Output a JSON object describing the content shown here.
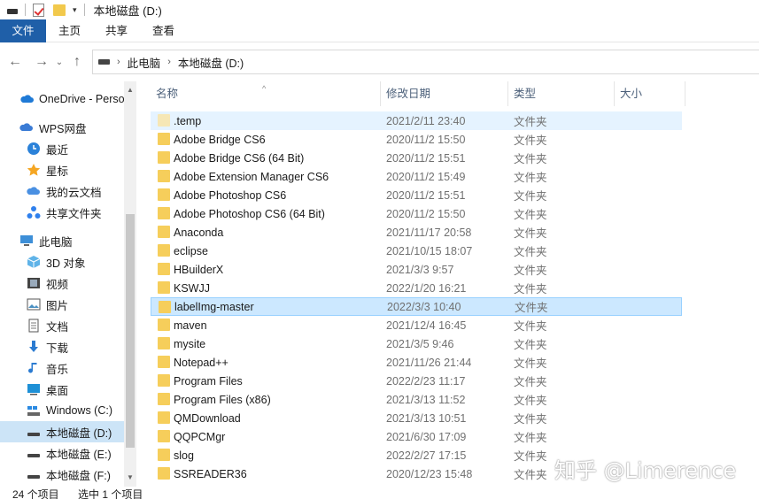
{
  "window": {
    "title": "本地磁盘 (D:)"
  },
  "ribbon": {
    "tabs": [
      "文件",
      "主页",
      "共享",
      "查看"
    ]
  },
  "address": {
    "crumbs": [
      "此电脑",
      "本地磁盘 (D:)"
    ]
  },
  "nav": {
    "items": [
      {
        "label": "OneDrive - Perso",
        "icon": "cloud-icon"
      },
      {
        "label": "WPS网盘",
        "icon": "wps-cloud-icon"
      },
      {
        "label": "最近",
        "icon": "clock-icon"
      },
      {
        "label": "星标",
        "icon": "star-icon"
      },
      {
        "label": "我的云文档",
        "icon": "cloud-doc-icon"
      },
      {
        "label": "共享文件夹",
        "icon": "share-folder-icon"
      },
      {
        "label": "此电脑",
        "icon": "computer-icon"
      },
      {
        "label": "3D 对象",
        "icon": "cube-icon"
      },
      {
        "label": "视频",
        "icon": "film-icon"
      },
      {
        "label": "图片",
        "icon": "picture-icon"
      },
      {
        "label": "文档",
        "icon": "document-icon"
      },
      {
        "label": "下载",
        "icon": "download-icon"
      },
      {
        "label": "音乐",
        "icon": "music-icon"
      },
      {
        "label": "桌面",
        "icon": "desktop-icon"
      },
      {
        "label": "Windows (C:)",
        "icon": "windows-drive-icon"
      },
      {
        "label": "本地磁盘 (D:)",
        "icon": "drive-icon"
      },
      {
        "label": "本地磁盘 (E:)",
        "icon": "drive-icon"
      },
      {
        "label": "本地磁盘 (F:)",
        "icon": "drive-icon"
      }
    ]
  },
  "columns": {
    "name": "名称",
    "date": "修改日期",
    "type": "类型",
    "size": "大小"
  },
  "files": [
    {
      "name": ".temp",
      "date": "2021/2/11 23:40",
      "type": "文件夹"
    },
    {
      "name": "Adobe Bridge CS6",
      "date": "2020/11/2 15:50",
      "type": "文件夹"
    },
    {
      "name": "Adobe Bridge CS6 (64 Bit)",
      "date": "2020/11/2 15:51",
      "type": "文件夹"
    },
    {
      "name": "Adobe Extension Manager CS6",
      "date": "2020/11/2 15:49",
      "type": "文件夹"
    },
    {
      "name": "Adobe Photoshop CS6",
      "date": "2020/11/2 15:51",
      "type": "文件夹"
    },
    {
      "name": "Adobe Photoshop CS6 (64 Bit)",
      "date": "2020/11/2 15:50",
      "type": "文件夹"
    },
    {
      "name": "Anaconda",
      "date": "2021/11/17 20:58",
      "type": "文件夹"
    },
    {
      "name": "eclipse",
      "date": "2021/10/15 18:07",
      "type": "文件夹"
    },
    {
      "name": "HBuilderX",
      "date": "2021/3/3 9:57",
      "type": "文件夹"
    },
    {
      "name": "KSWJJ",
      "date": "2022/1/20 16:21",
      "type": "文件夹"
    },
    {
      "name": "labelImg-master",
      "date": "2022/3/3 10:40",
      "type": "文件夹"
    },
    {
      "name": "maven",
      "date": "2021/12/4 16:45",
      "type": "文件夹"
    },
    {
      "name": "mysite",
      "date": "2021/3/5 9:46",
      "type": "文件夹"
    },
    {
      "name": "Notepad++",
      "date": "2021/11/26 21:44",
      "type": "文件夹"
    },
    {
      "name": "Program Files",
      "date": "2022/2/23 11:17",
      "type": "文件夹"
    },
    {
      "name": "Program Files (x86)",
      "date": "2021/3/13 11:52",
      "type": "文件夹"
    },
    {
      "name": "QMDownload",
      "date": "2021/3/13 10:51",
      "type": "文件夹"
    },
    {
      "name": "QQPCMgr",
      "date": "2021/6/30 17:09",
      "type": "文件夹"
    },
    {
      "name": "slog",
      "date": "2022/2/27 17:15",
      "type": "文件夹"
    },
    {
      "name": "SSREADER36",
      "date": "2020/12/23 15:48",
      "type": "文件夹"
    }
  ],
  "status": {
    "count": "24 个项目",
    "selection": "选中 1 个项目"
  },
  "watermark": "知乎 @Limerence",
  "colors": {
    "accent": "#1f5fa8",
    "selection": "#cce8ff",
    "folder": "#f6ce5b"
  }
}
